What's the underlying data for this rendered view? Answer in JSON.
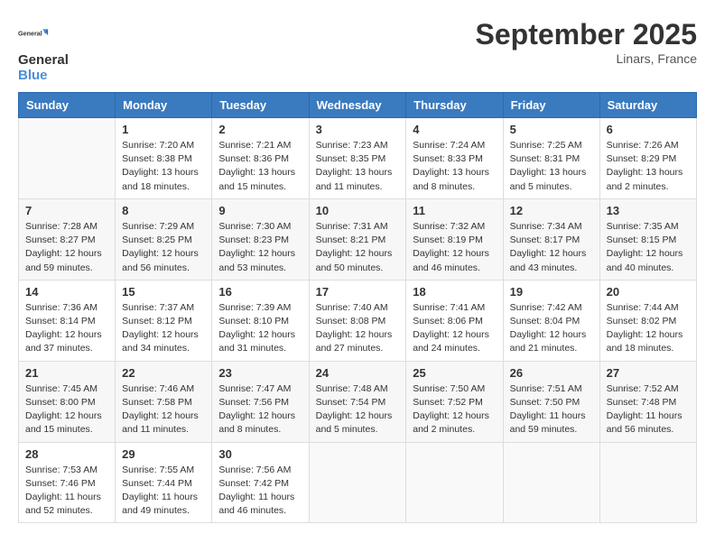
{
  "header": {
    "logo_line1": "General",
    "logo_line2": "Blue",
    "month": "September 2025",
    "location": "Linars, France"
  },
  "days_of_week": [
    "Sunday",
    "Monday",
    "Tuesday",
    "Wednesday",
    "Thursday",
    "Friday",
    "Saturday"
  ],
  "weeks": [
    [
      {
        "day": "",
        "info": ""
      },
      {
        "day": "1",
        "info": "Sunrise: 7:20 AM\nSunset: 8:38 PM\nDaylight: 13 hours\nand 18 minutes."
      },
      {
        "day": "2",
        "info": "Sunrise: 7:21 AM\nSunset: 8:36 PM\nDaylight: 13 hours\nand 15 minutes."
      },
      {
        "day": "3",
        "info": "Sunrise: 7:23 AM\nSunset: 8:35 PM\nDaylight: 13 hours\nand 11 minutes."
      },
      {
        "day": "4",
        "info": "Sunrise: 7:24 AM\nSunset: 8:33 PM\nDaylight: 13 hours\nand 8 minutes."
      },
      {
        "day": "5",
        "info": "Sunrise: 7:25 AM\nSunset: 8:31 PM\nDaylight: 13 hours\nand 5 minutes."
      },
      {
        "day": "6",
        "info": "Sunrise: 7:26 AM\nSunset: 8:29 PM\nDaylight: 13 hours\nand 2 minutes."
      }
    ],
    [
      {
        "day": "7",
        "info": "Sunrise: 7:28 AM\nSunset: 8:27 PM\nDaylight: 12 hours\nand 59 minutes."
      },
      {
        "day": "8",
        "info": "Sunrise: 7:29 AM\nSunset: 8:25 PM\nDaylight: 12 hours\nand 56 minutes."
      },
      {
        "day": "9",
        "info": "Sunrise: 7:30 AM\nSunset: 8:23 PM\nDaylight: 12 hours\nand 53 minutes."
      },
      {
        "day": "10",
        "info": "Sunrise: 7:31 AM\nSunset: 8:21 PM\nDaylight: 12 hours\nand 50 minutes."
      },
      {
        "day": "11",
        "info": "Sunrise: 7:32 AM\nSunset: 8:19 PM\nDaylight: 12 hours\nand 46 minutes."
      },
      {
        "day": "12",
        "info": "Sunrise: 7:34 AM\nSunset: 8:17 PM\nDaylight: 12 hours\nand 43 minutes."
      },
      {
        "day": "13",
        "info": "Sunrise: 7:35 AM\nSunset: 8:15 PM\nDaylight: 12 hours\nand 40 minutes."
      }
    ],
    [
      {
        "day": "14",
        "info": "Sunrise: 7:36 AM\nSunset: 8:14 PM\nDaylight: 12 hours\nand 37 minutes."
      },
      {
        "day": "15",
        "info": "Sunrise: 7:37 AM\nSunset: 8:12 PM\nDaylight: 12 hours\nand 34 minutes."
      },
      {
        "day": "16",
        "info": "Sunrise: 7:39 AM\nSunset: 8:10 PM\nDaylight: 12 hours\nand 31 minutes."
      },
      {
        "day": "17",
        "info": "Sunrise: 7:40 AM\nSunset: 8:08 PM\nDaylight: 12 hours\nand 27 minutes."
      },
      {
        "day": "18",
        "info": "Sunrise: 7:41 AM\nSunset: 8:06 PM\nDaylight: 12 hours\nand 24 minutes."
      },
      {
        "day": "19",
        "info": "Sunrise: 7:42 AM\nSunset: 8:04 PM\nDaylight: 12 hours\nand 21 minutes."
      },
      {
        "day": "20",
        "info": "Sunrise: 7:44 AM\nSunset: 8:02 PM\nDaylight: 12 hours\nand 18 minutes."
      }
    ],
    [
      {
        "day": "21",
        "info": "Sunrise: 7:45 AM\nSunset: 8:00 PM\nDaylight: 12 hours\nand 15 minutes."
      },
      {
        "day": "22",
        "info": "Sunrise: 7:46 AM\nSunset: 7:58 PM\nDaylight: 12 hours\nand 11 minutes."
      },
      {
        "day": "23",
        "info": "Sunrise: 7:47 AM\nSunset: 7:56 PM\nDaylight: 12 hours\nand 8 minutes."
      },
      {
        "day": "24",
        "info": "Sunrise: 7:48 AM\nSunset: 7:54 PM\nDaylight: 12 hours\nand 5 minutes."
      },
      {
        "day": "25",
        "info": "Sunrise: 7:50 AM\nSunset: 7:52 PM\nDaylight: 12 hours\nand 2 minutes."
      },
      {
        "day": "26",
        "info": "Sunrise: 7:51 AM\nSunset: 7:50 PM\nDaylight: 11 hours\nand 59 minutes."
      },
      {
        "day": "27",
        "info": "Sunrise: 7:52 AM\nSunset: 7:48 PM\nDaylight: 11 hours\nand 56 minutes."
      }
    ],
    [
      {
        "day": "28",
        "info": "Sunrise: 7:53 AM\nSunset: 7:46 PM\nDaylight: 11 hours\nand 52 minutes."
      },
      {
        "day": "29",
        "info": "Sunrise: 7:55 AM\nSunset: 7:44 PM\nDaylight: 11 hours\nand 49 minutes."
      },
      {
        "day": "30",
        "info": "Sunrise: 7:56 AM\nSunset: 7:42 PM\nDaylight: 11 hours\nand 46 minutes."
      },
      {
        "day": "",
        "info": ""
      },
      {
        "day": "",
        "info": ""
      },
      {
        "day": "",
        "info": ""
      },
      {
        "day": "",
        "info": ""
      }
    ]
  ]
}
